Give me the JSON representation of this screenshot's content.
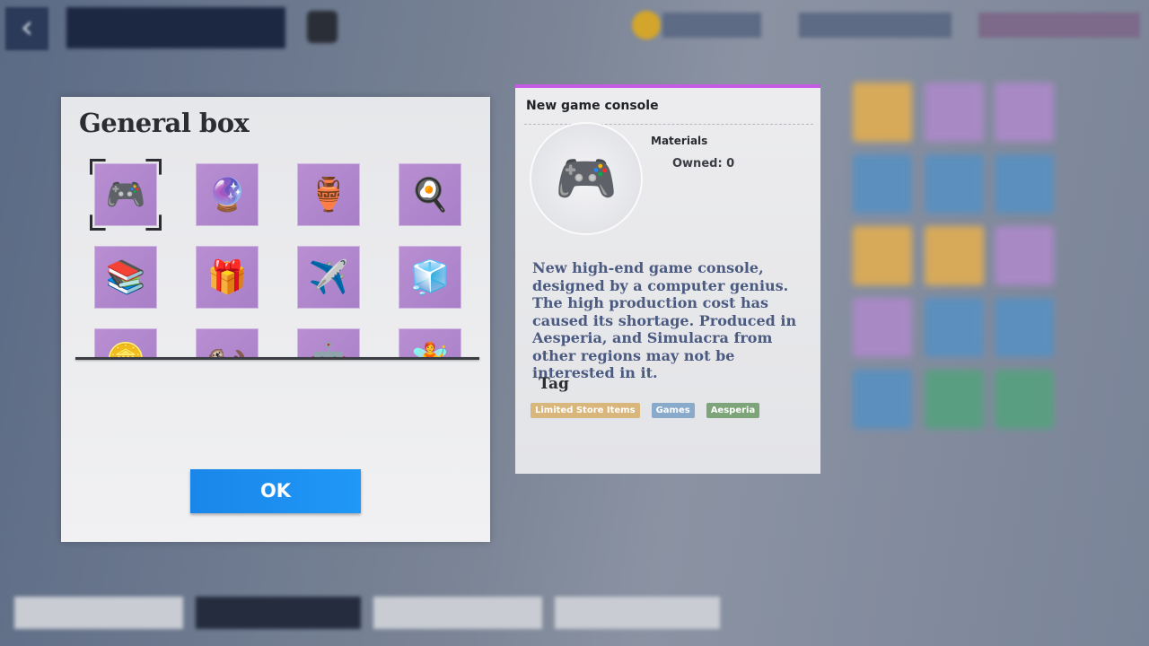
{
  "dialog": {
    "title": "General box",
    "ok_label": "OK",
    "items": [
      {
        "name": "New game console",
        "icon": "🎮",
        "selected": true
      },
      {
        "name": "crystal orb",
        "icon": "🔮"
      },
      {
        "name": "golden ornament",
        "icon": "🏺"
      },
      {
        "name": "cookware",
        "icon": "🍳"
      },
      {
        "name": "book set",
        "icon": "📚"
      },
      {
        "name": "gift box",
        "icon": "🎁"
      },
      {
        "name": "airship model",
        "icon": "✈️"
      },
      {
        "name": "ice cube",
        "icon": "🧊"
      },
      {
        "name": "coin",
        "icon": "🪙"
      },
      {
        "name": "otter figure",
        "icon": "🦦"
      },
      {
        "name": "robot figure",
        "icon": "🤖"
      },
      {
        "name": "fairy figure",
        "icon": "🧚"
      }
    ]
  },
  "detail": {
    "title": "New game console",
    "icon": "🎮",
    "category": "Materials",
    "owned": "Owned: 0",
    "description": "New high-end game console, designed by a computer genius. The high production cost has caused its shortage. Produced in Aesperia, and Simulacra from other regions may not be interested in it.",
    "tag_heading": "Tag",
    "tags": [
      {
        "label": "Limited Store Items",
        "color": "#d9b77c"
      },
      {
        "label": "Games",
        "color": "#8aaacb"
      },
      {
        "label": "Aesperia",
        "color": "#7ea57a"
      }
    ],
    "accent": "#c55ce6"
  },
  "colors": {
    "ok_button": "#1a8ff0",
    "tile": "#b28ad0"
  }
}
